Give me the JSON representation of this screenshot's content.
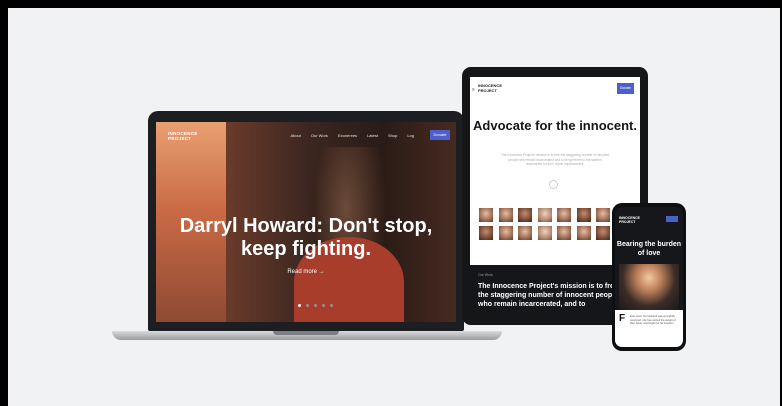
{
  "laptop": {
    "logo": "INNOCENCE\nPROJECT",
    "nav": [
      "About",
      "Our Work",
      "Exonerees",
      "Latest",
      "Shop",
      "Log"
    ],
    "cta": "Donate",
    "headline": "Darryl Howard: Don't stop, keep fighting.",
    "read_more": "Read more →",
    "slide_count": 5,
    "active_slide": 1
  },
  "tablet": {
    "logo": "INNOCENCE\nPROJECT",
    "menu": "≡",
    "donate": "Donate",
    "title": "Advocate for the innocent.",
    "subtitle": "The Innocence Project's mission is to free the staggering number of innocent people who remain incarcerated and to bring reform to the system responsible for their unjust imprisonment.",
    "face_count": 16,
    "dark_label": "Our Work",
    "mission": "The Innocence Project's mission is to free the staggering number of innocent people who remain incarcerated, and to"
  },
  "phone": {
    "logo": "INNOCENCE\nPROJECT",
    "title": "Bearing the burden of love",
    "card_letter": "F",
    "card_text": "Ever since her husband was wrongfully convicted, she has carried the weight of their family and fought for his freedom."
  },
  "colors": {
    "accent": "#4d5fc9",
    "background": "#f1f2f4",
    "device_frame": "#151618"
  }
}
